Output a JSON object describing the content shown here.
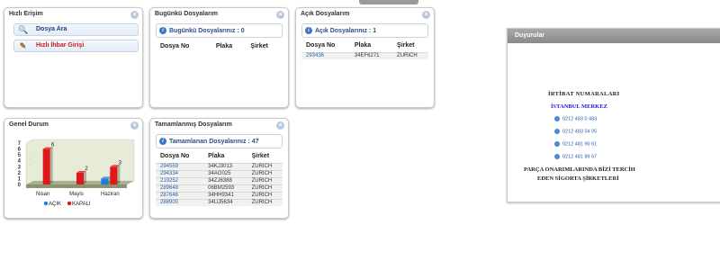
{
  "quick_access": {
    "title": "Hızlı Erişim",
    "items": [
      {
        "label": "Dosya Ara",
        "color": "#1d3f80",
        "icon": "search-icon"
      },
      {
        "label": "Hızlı İhbar Girişi",
        "color": "#d01818",
        "icon": "report-icon"
      }
    ]
  },
  "today_files": {
    "title": "Bugünkü Dosyalarım",
    "summary": "Bugünkü Dosyalarınız : 0",
    "columns": [
      "Dosya No",
      "Plaka",
      "Şirket"
    ],
    "rows": []
  },
  "open_files": {
    "title": "Açık Dosyalarım",
    "summary": "Açık Dosyalarınız : 1",
    "columns": [
      "Dosya No",
      "Plaka",
      "Şirket"
    ],
    "rows": [
      [
        "293436",
        "34EF6271",
        "ZURICH"
      ]
    ]
  },
  "general_status": {
    "title": "Genel Durum",
    "legend": [
      {
        "label": "AÇIK",
        "color": "#1b7fe0"
      },
      {
        "label": "KAPALI",
        "color": "#e01818"
      }
    ]
  },
  "completed_files": {
    "title": "Tamamlanmış Dosyalarım",
    "summary": "Tamamlanan Dosyalarınız : 47",
    "columns": [
      "Dosya No",
      "Plaka",
      "Şirket"
    ],
    "rows": [
      [
        "294559",
        "34KJ3013",
        "ZURICH"
      ],
      [
        "294334",
        "34AG025",
        "ZURICH"
      ],
      [
        "219252",
        "34ZJ6388",
        "ZURICH"
      ],
      [
        "289648",
        "06BM2593",
        "ZURICH"
      ],
      [
        "287646",
        "34HH9341",
        "ZURICH"
      ],
      [
        "288900",
        "34UJ5634",
        "ZURICH"
      ]
    ]
  },
  "announcements": {
    "title": "Duyurular",
    "heading": "İRTİBAT NUMARALARI",
    "region": "İSTANBUL MERKEZ",
    "phones": [
      "0212 483 0 483",
      "0212 483 04 05",
      "0212 481 90 61",
      "0212 481 89 67"
    ],
    "footer_line1": "PARÇA ONARIMLARINDA BİZİ TERCİH",
    "footer_line2": "EDEN SİGORTA ŞİRKETLERİ"
  },
  "chart_data": {
    "type": "bar",
    "categories": [
      "Nisan",
      "Mayis",
      "Haziran"
    ],
    "series": [
      {
        "name": "AÇIK",
        "values": [
          0,
          0,
          1
        ]
      },
      {
        "name": "KAPALI",
        "values": [
          6,
          2,
          3
        ]
      }
    ],
    "yticks": [
      "7",
      "6",
      "5",
      "4",
      "3",
      "2",
      "1",
      "0"
    ],
    "ylim": [
      0,
      7
    ],
    "colors": {
      "AÇIK": "#1b7fe0",
      "KAPALI": "#e01818"
    },
    "legend_position": "bottom"
  }
}
